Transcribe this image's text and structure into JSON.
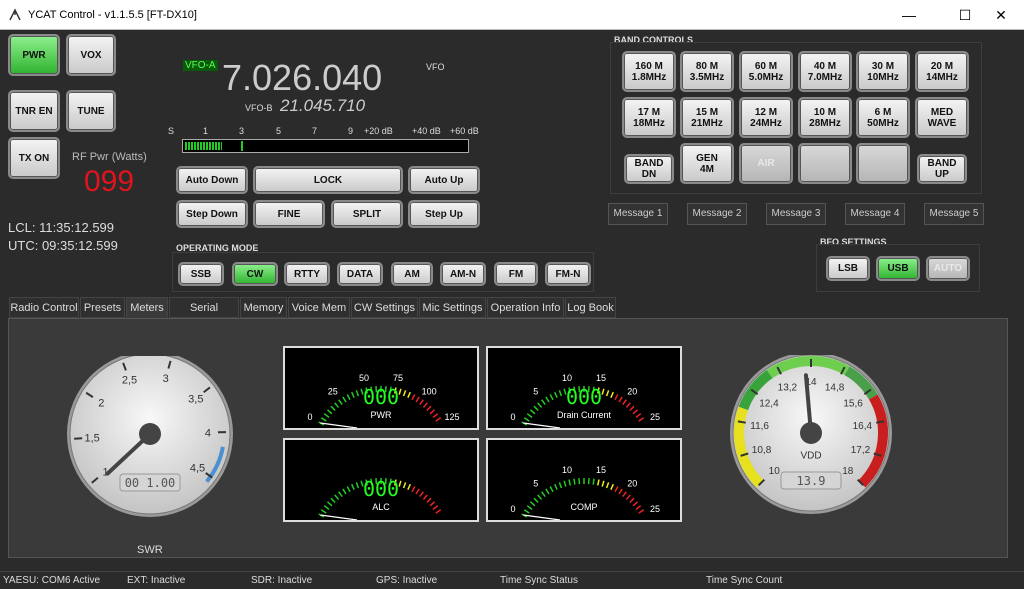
{
  "window": {
    "title": "YCAT Control - v1.1.5.5  [FT-DX10]",
    "minimize": "—",
    "maximize": "☐",
    "close": "✕"
  },
  "left_buttons": {
    "pwr": "PWR",
    "vox": "VOX",
    "tnr": "TNR EN",
    "tune": "TUNE",
    "tx": "TX ON"
  },
  "rf_power": {
    "label": "RF Pwr (Watts)",
    "value": "099"
  },
  "clock": {
    "lcl": "LCL: 11:35:12.599",
    "utc": "UTC: 09:35:12.599"
  },
  "vfo": {
    "a_tag": "VFO-A",
    "a_freq": "7.026.040",
    "vfo_label": "VFO",
    "b_tag": "VFO-B",
    "b_freq": "21.045.710"
  },
  "smeter": {
    "scale": [
      "S",
      "1",
      "3",
      "5",
      "7",
      "9",
      "+20 dB",
      "+40 dB",
      "+60 dB"
    ],
    "level": 0.13
  },
  "vfo_buttons": {
    "auto_down": "Auto Down",
    "lock": "LOCK",
    "auto_up": "Auto Up",
    "step_down": "Step Down",
    "fine": "FINE",
    "split": "SPLIT",
    "step_up": "Step Up"
  },
  "op_mode": {
    "title": "OPERATING MODE",
    "modes": [
      "SSB",
      "CW",
      "RTTY",
      "DATA",
      "AM",
      "AM-N",
      "FM",
      "FM-N"
    ],
    "active": "CW"
  },
  "band_controls": {
    "title": "BAND CONTROLS",
    "row1": [
      "160 M\n1.8MHz",
      "80 M\n3.5MHz",
      "60 M\n5.0MHz",
      "40 M\n7.0MHz",
      "30 M\n10MHz",
      "20 M\n14MHz"
    ],
    "row2": [
      "17 M\n18MHz",
      "15 M\n21MHz",
      "12 M\n24MHz",
      "10 M\n28MHz",
      "6 M\n50MHz",
      "MED\nWAVE"
    ],
    "row3": [
      "BAND\nDN",
      "GEN\n4M",
      "AIR",
      "",
      "",
      "BAND\nUP"
    ]
  },
  "messages": [
    "Message 1",
    "Message 2",
    "Message 3",
    "Message 4",
    "Message 5"
  ],
  "bfo": {
    "title": "BFO SETTINGS",
    "lsb": "LSB",
    "usb": "USB",
    "auto": "AUTO"
  },
  "tabs": [
    "Radio Control",
    "Presets",
    "Meters",
    "Serial Comms",
    "Memory",
    "Voice Mem",
    "CW Settings",
    "Mic Settings",
    "Operation Info",
    "Log Book"
  ],
  "active_tab": "Meters",
  "swr_gauge": {
    "ticks": [
      "1",
      "1,5",
      "2",
      "2,5",
      "3",
      "3,5",
      "4",
      "4,5"
    ],
    "readout": "00 1.00",
    "label": "SWR"
  },
  "vdd_gauge": {
    "ticks": [
      "10",
      "10,8",
      "11,6",
      "12,4",
      "13,2",
      "14",
      "14,8",
      "15,6",
      "16,4",
      "17,2",
      "18"
    ],
    "readout": "13.9",
    "label": "VDD"
  },
  "meters": {
    "pwr": {
      "label": "PWR",
      "ticks": [
        "0",
        "25",
        "50",
        "75",
        "100",
        "125"
      ],
      "digits": "000"
    },
    "drain": {
      "label": "Drain Current",
      "ticks": [
        "0",
        "5",
        "10",
        "15",
        "20",
        "25"
      ],
      "digits": "000"
    },
    "alc": {
      "label": "ALC",
      "ticks": [],
      "digits": "000"
    },
    "comp": {
      "label": "COMP",
      "ticks": [
        "0",
        "5",
        "10",
        "15",
        "20",
        "25"
      ],
      "digits": ""
    }
  },
  "status_bar": {
    "yaesu": "YAESU: COM6 Active",
    "ext": "EXT:  Inactive",
    "sdr": "SDR: Inactive",
    "gps": "GPS: Inactive",
    "time_sync": "Time Sync Status",
    "time_sync_count": "Time Sync Count"
  },
  "colors": {
    "green_on": "#2fb32f",
    "rf_red": "#e0141e",
    "lcd_green": "#22ff22"
  }
}
